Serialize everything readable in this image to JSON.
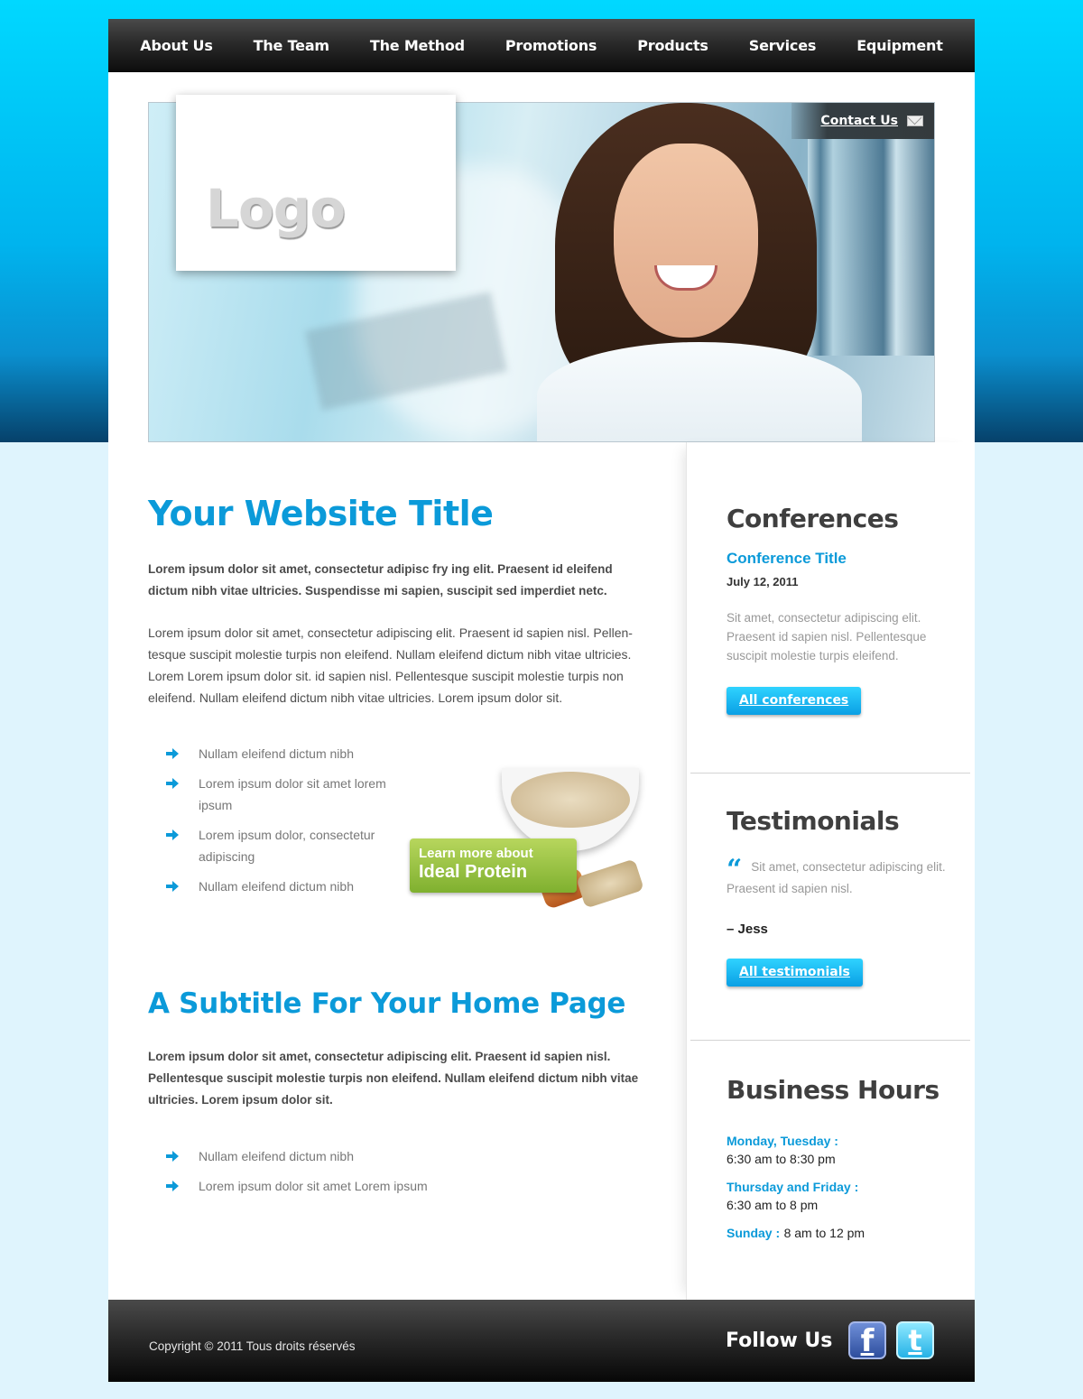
{
  "nav": {
    "items": [
      "About Us",
      "The Team",
      "The Method",
      "Promotions",
      "Products",
      "Services",
      "Equipment"
    ]
  },
  "hero": {
    "logo_text": "Logo",
    "contact_label": "Contact Us"
  },
  "main": {
    "title": "Your Website Title",
    "lead": "Lorem ipsum dolor sit amet, consectetur adipisc fry ing elit. Praesent id eleifend dictum nibh vitae ultricies. Suspendisse mi sapien, suscipit sed imperdiet netc.",
    "paragraph": "Lorem ipsum dolor sit amet, consectetur adipiscing elit. Praesent id sapien nisl. Pellen-tesque suscipit molestie turpis non eleifend. Nullam eleifend dictum nibh vitae ultricies. Lorem Lorem ipsum dolor sit. id sapien nisl. Pellentesque suscipit molestie turpis non eleifend. Nullam eleifend dictum nibh vitae ultricies. Lorem ipsum dolor sit.",
    "bullets": [
      "Nullam eleifend dictum nibh",
      "Lorem ipsum dolor sit amet lorem ipsum",
      "Lorem ipsum dolor, consectetur adipiscing",
      "Nullam eleifend dictum nibh"
    ],
    "promo": {
      "line1": "Learn more about",
      "line2": "Ideal Protein"
    },
    "subtitle": "A Subtitle For Your Home Page",
    "lead2": "Lorem ipsum dolor sit amet, consectetur adipiscing elit. Praesent id sapien nisl. Pellentesque suscipit molestie turpis non eleifend. Nullam eleifend dictum nibh vitae ultricies. Lorem ipsum dolor sit.",
    "bullets2": [
      "Nullam eleifend dictum nibh",
      "Lorem ipsum dolor sit amet Lorem ipsum"
    ]
  },
  "sidebar": {
    "conferences": {
      "heading": "Conferences",
      "title": "Conference Title",
      "date": "July 12, 2011",
      "text": "Sit amet, consectetur adipiscing elit. Praesent id sapien nisl. Pellentesque suscipit molestie turpis eleifend.",
      "button": "All conferences"
    },
    "testimonials": {
      "heading": "Testimonials",
      "quote_mark": "“",
      "text": "Sit amet, consectetur adipiscing elit. Praesent id sapien nisl.",
      "author": "– Jess",
      "button": "All testimonials"
    },
    "hours": {
      "heading": "Business Hours",
      "rows": [
        {
          "label": "Monday, Tuesday :",
          "value": "6:30 am to 8:30 pm"
        },
        {
          "label": "Thursday and Friday :",
          "value": "6:30 am to 8 pm"
        },
        {
          "label": "Sunday :",
          "value": "8 am to 12 pm"
        }
      ]
    }
  },
  "footer": {
    "copyright": "Copyright © 2011 Tous droits réservés",
    "follow": "Follow Us",
    "facebook_glyph": "f",
    "twitter_glyph": "t"
  },
  "colors": {
    "accent": "#0b9ad9",
    "button": "#15b6ef",
    "nav_bg": "#1a1a1a",
    "page_bg": "#dff4fd"
  },
  "icons": {
    "bullet": "arrow-right-icon",
    "mail": "envelope-icon",
    "facebook": "facebook-icon",
    "twitter": "twitter-icon"
  }
}
